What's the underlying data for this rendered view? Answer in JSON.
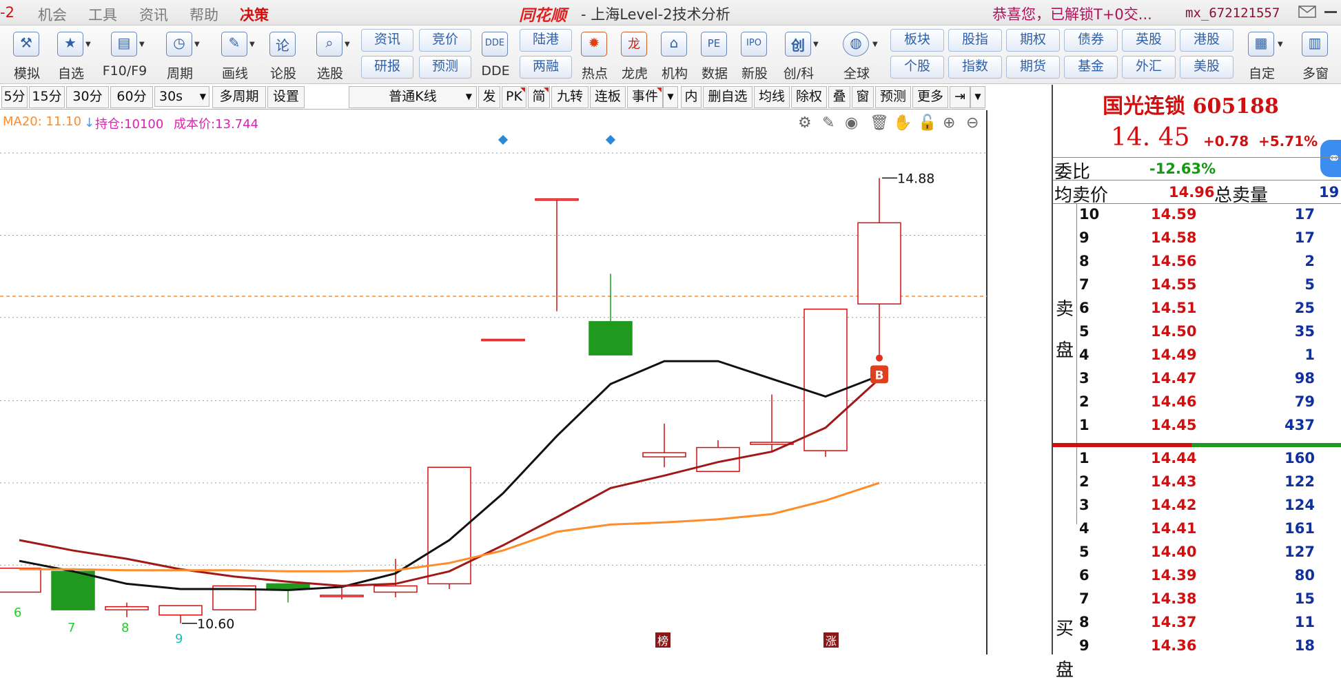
{
  "app": {
    "menu": [
      "-2",
      "机会",
      "工具",
      "资讯",
      "帮助",
      "决策"
    ],
    "brand": "同花顺",
    "title": "- 上海Level-2技术分析",
    "notice": "恭喜您，已解锁T+0交...",
    "user": "mx_672121557"
  },
  "toolbar": {
    "big": [
      {
        "label": "模拟",
        "icon": "gavel-icon",
        "glyph": "⚒"
      },
      {
        "label": "自选",
        "icon": "star-folder-icon",
        "glyph": "★"
      },
      {
        "label": "F10/F9",
        "icon": "document-icon",
        "glyph": "▤"
      },
      {
        "label": "周期",
        "icon": "clock-icon",
        "glyph": "◷"
      },
      {
        "label": "画线",
        "icon": "pen-icon",
        "glyph": "✎"
      },
      {
        "label": "论股",
        "icon": "discuss-icon",
        "glyph": "论"
      },
      {
        "label": "选股",
        "icon": "chart-search-icon",
        "glyph": "⌕"
      }
    ],
    "pair1": [
      "资讯",
      "研报"
    ],
    "pair2": [
      "竞价",
      "预测"
    ],
    "ddeLabel": "DDE",
    "pair3": [
      "陆港",
      "两融"
    ],
    "big2": [
      {
        "label": "热点",
        "icon": "hot-icon",
        "glyph": "🔥"
      },
      {
        "label": "龙虎",
        "icon": "dragon-icon",
        "glyph": "龙"
      },
      {
        "label": "机构",
        "icon": "bank-icon",
        "glyph": "🏛"
      },
      {
        "label": "数据",
        "icon": "pe-icon",
        "glyph": "PE"
      },
      {
        "label": "新股",
        "icon": "ipo-icon",
        "glyph": "IPO"
      },
      {
        "label": "创/科",
        "icon": "chuang-icon",
        "glyph": "创"
      },
      {
        "label": "全球",
        "icon": "globe-icon",
        "glyph": "◍"
      }
    ],
    "pairs": [
      [
        "板块",
        "个股"
      ],
      [
        "股指",
        "指数"
      ],
      [
        "期权",
        "期货"
      ],
      [
        "债券",
        "基金"
      ],
      [
        "英股",
        "外汇"
      ],
      [
        "港股",
        "美股"
      ]
    ],
    "big3": [
      {
        "label": "自定",
        "icon": "custom-icon",
        "glyph": "▦"
      },
      {
        "label": "多窗",
        "icon": "windows-icon",
        "glyph": "▥"
      }
    ]
  },
  "periodbar": {
    "periods": [
      "5分",
      "15分",
      "30分",
      "60分"
    ],
    "sec": "30s",
    "others": [
      "多周期",
      "设置"
    ],
    "kline": "普通K线",
    "tabs": [
      "发",
      "PK",
      "简",
      "九转",
      "连板",
      "事件"
    ],
    "tabs2": [
      "内",
      "删自选",
      "均线",
      "除权",
      "叠",
      "窗",
      "预测",
      "更多"
    ]
  },
  "chart": {
    "ma_label": "MA20: 11.10",
    "position_label": "持仓:10100",
    "cost_label": "成本价:13.744",
    "price_ticks": [
      "15.12",
      "14.33",
      "13.54",
      "12.74",
      "11.95",
      "11.16"
    ],
    "high_label": "14.88",
    "low_label": "10.60",
    "buy_marker": "B",
    "bottom_labels": [
      "6",
      "7",
      "8",
      "9"
    ],
    "event_badges": [
      "榜",
      "涨"
    ],
    "colors": {
      "up": "#d01010",
      "down": "#1f9a1f",
      "ma_black": "#111111",
      "ma_red": "#a01818",
      "ma_orange": "#ff8c28"
    }
  },
  "chart_data": {
    "type": "candlestick",
    "title": "",
    "ylim": [
      10.4,
      15.3
    ],
    "y_ticks": [
      15.12,
      14.33,
      13.54,
      12.74,
      11.95,
      11.16
    ],
    "cost_line": 13.744,
    "x": [
      "6",
      "7",
      "8",
      "9",
      "",
      "",
      "",
      "",
      "",
      "",
      "",
      "",
      "",
      "",
      "",
      ""
    ],
    "candles": [
      {
        "open": 10.9,
        "close": 11.13,
        "high": 11.13,
        "low": 10.9
      },
      {
        "open": 11.1,
        "close": 10.73,
        "high": 11.13,
        "low": 10.73
      },
      {
        "open": 10.73,
        "close": 10.76,
        "high": 10.8,
        "low": 10.66
      },
      {
        "open": 10.68,
        "close": 10.77,
        "high": 10.77,
        "low": 10.6
      },
      {
        "open": 10.73,
        "close": 10.96,
        "high": 10.96,
        "low": 10.73
      },
      {
        "open": 10.98,
        "close": 10.93,
        "high": 10.98,
        "low": 10.8
      },
      {
        "open": 10.86,
        "close": 10.87,
        "high": 10.95,
        "low": 10.83
      },
      {
        "open": 10.9,
        "close": 10.96,
        "high": 11.22,
        "low": 10.85
      },
      {
        "open": 10.98,
        "close": 12.1,
        "high": 12.1,
        "low": 10.93
      },
      {
        "open": 13.33,
        "close": 13.33,
        "high": 13.33,
        "low": 13.33
      },
      {
        "open": 14.68,
        "close": 14.68,
        "high": 14.68,
        "low": 13.6
      },
      {
        "open": 13.5,
        "close": 13.18,
        "high": 13.96,
        "low": 13.18
      },
      {
        "open": 12.2,
        "close": 12.24,
        "high": 12.52,
        "low": 12.1
      },
      {
        "open": 12.06,
        "close": 12.29,
        "high": 12.36,
        "low": 12.06
      },
      {
        "open": 12.32,
        "close": 12.34,
        "high": 12.8,
        "low": 12.26
      },
      {
        "open": 12.26,
        "close": 13.62,
        "high": 13.62,
        "low": 12.2
      },
      {
        "open": 13.67,
        "close": 14.45,
        "high": 14.88,
        "low": 13.15
      }
    ],
    "series": [
      {
        "values": [
          11.2,
          11.1,
          10.98,
          10.93,
          10.93,
          10.92,
          10.95,
          11.08,
          11.4,
          11.85,
          12.4,
          12.9,
          13.12,
          13.12,
          12.95,
          12.78,
          12.98
        ]
      },
      {
        "values": [
          11.4,
          11.3,
          11.22,
          11.12,
          11.05,
          11.0,
          10.96,
          10.98,
          11.1,
          11.35,
          11.62,
          11.9,
          12.02,
          12.15,
          12.25,
          12.48,
          12.95
        ]
      },
      {
        "values": [
          11.12,
          11.12,
          11.11,
          11.11,
          11.11,
          11.1,
          11.1,
          11.11,
          11.18,
          11.3,
          11.48,
          11.55,
          11.57,
          11.6,
          11.65,
          11.78,
          11.95
        ]
      }
    ]
  },
  "quote": {
    "name": "国光连锁 605188",
    "price": "14. 45",
    "change": "+0.78",
    "pct": "+5.71%",
    "weibi_label": "委比",
    "weibi_val": "-12.63%",
    "avg_sell_label": "均卖价",
    "avg_sell_val": "14.96",
    "total_sell_label": "总卖量",
    "total_sell_val": "19",
    "sell_side": "卖盘",
    "buy_side": "买盘"
  },
  "orderbook": {
    "asks": [
      {
        "n": "10",
        "p": "14.59",
        "v": "17"
      },
      {
        "n": "9",
        "p": "14.58",
        "v": "17"
      },
      {
        "n": "8",
        "p": "14.56",
        "v": "2"
      },
      {
        "n": "7",
        "p": "14.55",
        "v": "5"
      },
      {
        "n": "6",
        "p": "14.51",
        "v": "25"
      },
      {
        "n": "5",
        "p": "14.50",
        "v": "35"
      },
      {
        "n": "4",
        "p": "14.49",
        "v": "1"
      },
      {
        "n": "3",
        "p": "14.47",
        "v": "98"
      },
      {
        "n": "2",
        "p": "14.46",
        "v": "79"
      },
      {
        "n": "1",
        "p": "14.45",
        "v": "437"
      }
    ],
    "bids": [
      {
        "n": "1",
        "p": "14.44",
        "v": "160"
      },
      {
        "n": "2",
        "p": "14.43",
        "v": "122"
      },
      {
        "n": "3",
        "p": "14.42",
        "v": "124"
      },
      {
        "n": "4",
        "p": "14.41",
        "v": "161"
      },
      {
        "n": "5",
        "p": "14.40",
        "v": "127"
      },
      {
        "n": "6",
        "p": "14.39",
        "v": "80"
      },
      {
        "n": "7",
        "p": "14.38",
        "v": "15"
      },
      {
        "n": "8",
        "p": "14.37",
        "v": "11"
      },
      {
        "n": "9",
        "p": "14.36",
        "v": "18"
      }
    ]
  }
}
